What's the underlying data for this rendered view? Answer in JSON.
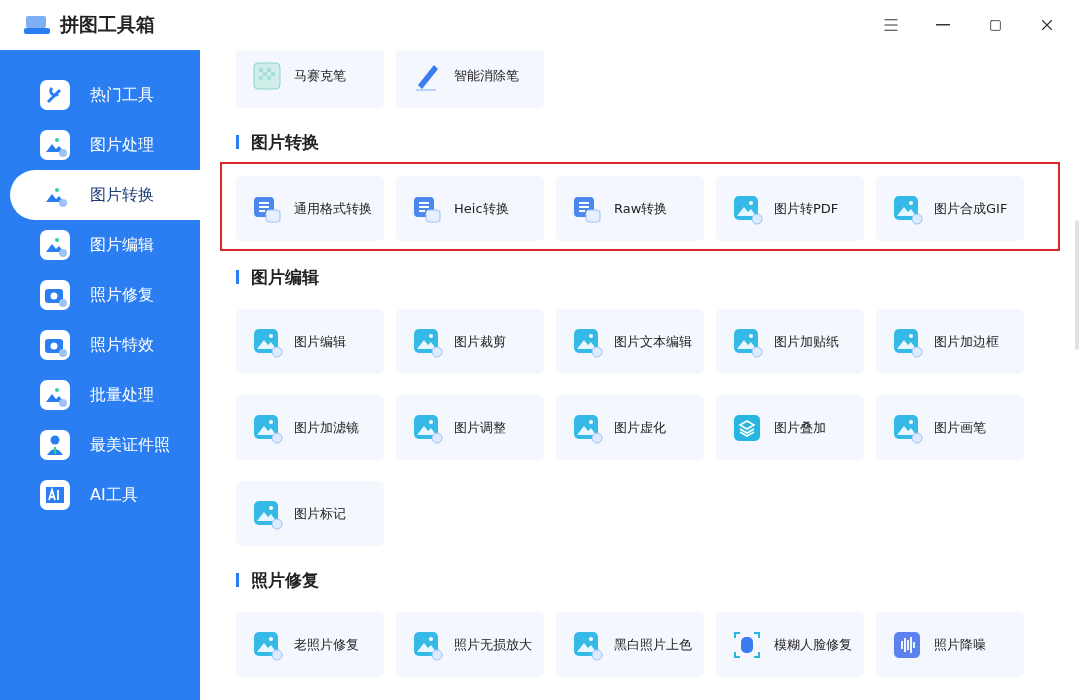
{
  "window": {
    "title": "拼图工具箱"
  },
  "sidebar": {
    "items": [
      {
        "label": "热门工具",
        "kind": "wrench",
        "selected": false
      },
      {
        "label": "图片处理",
        "kind": "image",
        "selected": false
      },
      {
        "label": "图片转换",
        "kind": "image",
        "selected": true
      },
      {
        "label": "图片编辑",
        "kind": "image",
        "selected": false
      },
      {
        "label": "照片修复",
        "kind": "camera",
        "selected": false
      },
      {
        "label": "照片特效",
        "kind": "camera",
        "selected": false
      },
      {
        "label": "批量处理",
        "kind": "image",
        "selected": false
      },
      {
        "label": "最美证件照",
        "kind": "person",
        "selected": false
      },
      {
        "label": "AI工具",
        "kind": "ai",
        "selected": false
      }
    ]
  },
  "sections": [
    {
      "tools": [
        {
          "label": "马赛克笔",
          "kind": "mosaic"
        },
        {
          "label": "智能消除笔",
          "kind": "pen"
        }
      ]
    },
    {
      "title": "图片转换",
      "highlighted": true,
      "tools": [
        {
          "label": "通用格式转换",
          "kind": "doc"
        },
        {
          "label": "Heic转换",
          "kind": "doc"
        },
        {
          "label": "Raw转换",
          "kind": "doc"
        },
        {
          "label": "图片转PDF",
          "kind": "image"
        },
        {
          "label": "图片合成GIF",
          "kind": "image"
        }
      ]
    },
    {
      "title": "图片编辑",
      "highlighted": false,
      "tools": [
        {
          "label": "图片编辑",
          "kind": "image"
        },
        {
          "label": "图片裁剪",
          "kind": "image"
        },
        {
          "label": "图片文本编辑",
          "kind": "image"
        },
        {
          "label": "图片加贴纸",
          "kind": "image"
        },
        {
          "label": "图片加边框",
          "kind": "image"
        },
        {
          "label": "图片加滤镜",
          "kind": "image"
        },
        {
          "label": "图片调整",
          "kind": "image"
        },
        {
          "label": "图片虚化",
          "kind": "image"
        },
        {
          "label": "图片叠加",
          "kind": "layers"
        },
        {
          "label": "图片画笔",
          "kind": "image"
        },
        {
          "label": "图片标记",
          "kind": "image"
        }
      ]
    },
    {
      "title": "照片修复",
      "highlighted": false,
      "tools": [
        {
          "label": "老照片修复",
          "kind": "image"
        },
        {
          "label": "照片无损放大",
          "kind": "image"
        },
        {
          "label": "黑白照片上色",
          "kind": "image"
        },
        {
          "label": "模糊人脸修复",
          "kind": "face"
        },
        {
          "label": "照片降噪",
          "kind": "wave"
        }
      ]
    }
  ]
}
